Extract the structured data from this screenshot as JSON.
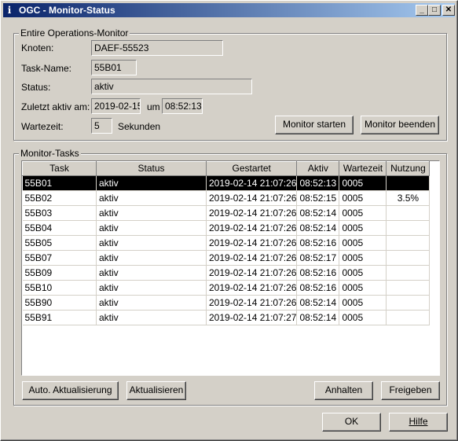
{
  "window": {
    "title": "OGC - Monitor-Status"
  },
  "operations": {
    "legend": "Entire Operations-Monitor",
    "knoten_label": "Knoten:",
    "knoten_value": "DAEF-55523",
    "taskname_label": "Task-Name:",
    "taskname_value": "55B01",
    "status_label": "Status:",
    "status_value": "aktiv",
    "zuletzt_label": "Zuletzt aktiv am:",
    "zuletzt_date": "2019-02-15",
    "um_label": "um",
    "zuletzt_time": "08:52:13",
    "wartezeit_label": "Wartezeit:",
    "wartezeit_value": "5",
    "sekunden_label": "Sekunden",
    "start_button": "Monitor starten",
    "stop_button": "Monitor beenden"
  },
  "tasks": {
    "legend": "Monitor-Tasks",
    "columns": [
      "Task",
      "Status",
      "Gestartet",
      "Aktiv",
      "Wartezeit",
      "Nutzung"
    ],
    "rows": [
      {
        "task": "55B01",
        "status": "aktiv",
        "gestartet": "2019-02-14 21:07:26",
        "aktiv": "08:52:13",
        "wartezeit": "0005",
        "nutzung": "",
        "selected": true
      },
      {
        "task": "55B02",
        "status": "aktiv",
        "gestartet": "2019-02-14 21:07:26",
        "aktiv": "08:52:15",
        "wartezeit": "0005",
        "nutzung": "3.5%"
      },
      {
        "task": "55B03",
        "status": "aktiv",
        "gestartet": "2019-02-14 21:07:26",
        "aktiv": "08:52:14",
        "wartezeit": "0005",
        "nutzung": ""
      },
      {
        "task": "55B04",
        "status": "aktiv",
        "gestartet": "2019-02-14 21:07:26",
        "aktiv": "08:52:14",
        "wartezeit": "0005",
        "nutzung": ""
      },
      {
        "task": "55B05",
        "status": "aktiv",
        "gestartet": "2019-02-14 21:07:26",
        "aktiv": "08:52:16",
        "wartezeit": "0005",
        "nutzung": ""
      },
      {
        "task": "55B07",
        "status": "aktiv",
        "gestartet": "2019-02-14 21:07:26",
        "aktiv": "08:52:17",
        "wartezeit": "0005",
        "nutzung": ""
      },
      {
        "task": "55B09",
        "status": "aktiv",
        "gestartet": "2019-02-14 21:07:26",
        "aktiv": "08:52:16",
        "wartezeit": "0005",
        "nutzung": ""
      },
      {
        "task": "55B10",
        "status": "aktiv",
        "gestartet": "2019-02-14 21:07:26",
        "aktiv": "08:52:16",
        "wartezeit": "0005",
        "nutzung": ""
      },
      {
        "task": "55B90",
        "status": "aktiv",
        "gestartet": "2019-02-14 21:07:26",
        "aktiv": "08:52:14",
        "wartezeit": "0005",
        "nutzung": ""
      },
      {
        "task": "55B91",
        "status": "aktiv",
        "gestartet": "2019-02-14 21:07:27",
        "aktiv": "08:52:14",
        "wartezeit": "0005",
        "nutzung": ""
      }
    ],
    "auto_refresh_button": "Auto. Aktualisierung",
    "refresh_button": "Aktualisieren",
    "pause_button": "Anhalten",
    "release_button": "Freigeben"
  },
  "footer": {
    "ok_button": "OK",
    "help_button": "Hilfe"
  }
}
